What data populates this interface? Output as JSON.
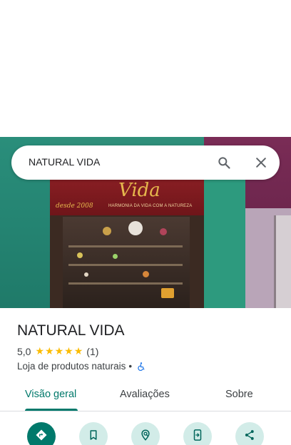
{
  "search": {
    "query": "NATURAL VIDA"
  },
  "photo": {
    "sign_main": "Vida",
    "sign_year": "desde 2008",
    "sign_subtitle": "HARMONIA DA VIDA COM A NATUREZA"
  },
  "place": {
    "name": "NATURAL VIDA",
    "rating": "5,0",
    "stars": 5,
    "review_count": "(1)",
    "category": "Loja de produtos naturais",
    "separator": "•"
  },
  "tabs": [
    {
      "label": "Visão geral",
      "active": true
    },
    {
      "label": "Avaliações",
      "active": false
    },
    {
      "label": "Sobre",
      "active": false
    }
  ],
  "actions": [
    {
      "icon": "directions-icon"
    },
    {
      "icon": "bookmark-icon"
    },
    {
      "icon": "nearby-icon"
    },
    {
      "icon": "send-to-phone-icon"
    },
    {
      "icon": "share-icon"
    }
  ],
  "colors": {
    "accent": "#00796b",
    "star": "#fbbc04",
    "action_bg": "#d2ece8",
    "wheelchair": "#1a73e8"
  }
}
